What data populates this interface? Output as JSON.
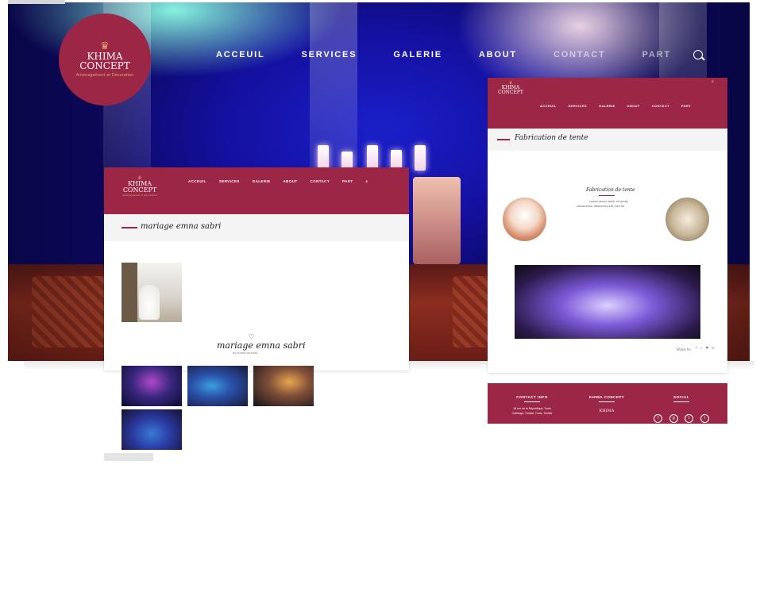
{
  "main": {
    "brand_line1": "KHIMA",
    "brand_line2": "CONCEPT",
    "brand_tagline": "Aménagement et Décoration",
    "nav": [
      "ACCEUIL",
      "SERVICES",
      "GALERIE",
      "ABOUT",
      "CONTACT",
      "PART"
    ]
  },
  "card_left": {
    "brand_line1": "KHIMA",
    "brand_line2": "CONCEPT",
    "brand_tagline": "Aménagement et Décoration",
    "nav": [
      "ACCEUIL",
      "SERVICES",
      "GALERIE",
      "ABOUT",
      "CONTACT",
      "PART"
    ],
    "page_title": "mariage emna sabri",
    "gallery_title": "mariage emna sabri",
    "gallery_sub": "by khima concept",
    "heart": "♡"
  },
  "card_right": {
    "brand_line1": "KHIMA",
    "brand_line2": "CONCEPT",
    "nav": [
      "ACCEUIL",
      "SERVICES",
      "GALERIE",
      "ABOUT",
      "CONTACT",
      "PART"
    ],
    "page_title": "Fabrication de tente",
    "section_title": "Fabrication de tente",
    "section_text_1": "Lorem ipsum dolor sit amet,",
    "section_text_2": "consectetur adipiscing elit, sed do",
    "share_label": "Share to:"
  },
  "footer": {
    "col1_title": "CONTACT INFO",
    "col1_line1": "18 rue de la République, Tunis",
    "col1_line2": "Carthage, Tunisie, Tunis, Tunisie",
    "col2_title": "KHIMA CONCEPT",
    "col2_logo": "KHIMA",
    "col3_title": "SOCIAL",
    "social": [
      "f",
      "g",
      "t",
      "i"
    ]
  },
  "colors": {
    "brand": "#9b2645",
    "gold": "#e2a86c"
  }
}
